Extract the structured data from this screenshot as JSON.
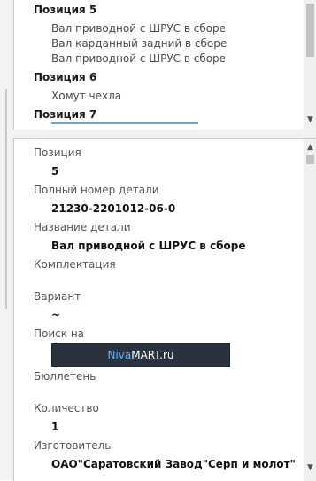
{
  "parts_list": {
    "groups": [
      {
        "header": "Позиция 5",
        "items": [
          "Вал приводной с ШРУС в сборе",
          "Вал карданный задний в сборе",
          "Вал приводной с ШРУС в сборе"
        ]
      },
      {
        "header": "Позиция 6",
        "items": [
          "Хомут чехла"
        ]
      },
      {
        "header": "Позиция 7",
        "items": []
      }
    ]
  },
  "properties": {
    "position": {
      "label": "Позиция",
      "value": "5"
    },
    "full_number": {
      "label": "Полный номер детали",
      "value": "21230-2201012-06-0"
    },
    "name": {
      "label": "Название детали",
      "value": "Вал приводной с ШРУС в сборе"
    },
    "kit": {
      "label": "Комплектация",
      "value": ""
    },
    "variant": {
      "label": "Вариант",
      "value": "~"
    },
    "search": {
      "label": "Поиск на",
      "link_left": "Niva",
      "link_right": "MART.ru"
    },
    "bulletin": {
      "label": "Бюллетень",
      "value": ""
    },
    "quantity": {
      "label": "Количество",
      "value": "1"
    },
    "manufacturer": {
      "label": "Изготовитель",
      "value": "ОАО\"Саратовский Завод\"Серп и молот\""
    }
  },
  "colors": {
    "link_niva": "#5fb3ff",
    "link_mart": "#ffffff",
    "link_bg": "#2a3240"
  }
}
